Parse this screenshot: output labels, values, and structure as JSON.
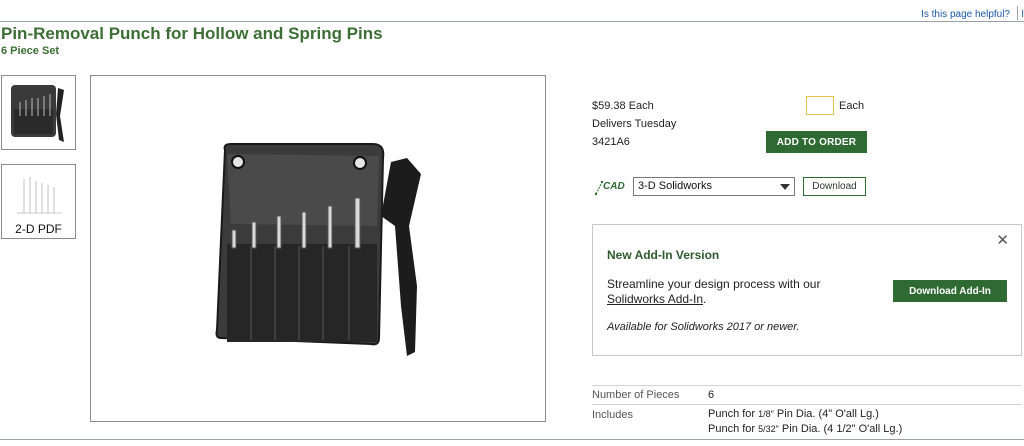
{
  "header": {
    "helpful_text": "Is this page helpful?",
    "helpful_tail": "I"
  },
  "product": {
    "title": "Pin-Removal Punch for Hollow and Spring Pins",
    "subtitle": "6 Piece Set"
  },
  "thumbnails": {
    "pdf_caption": "2-D PDF"
  },
  "order": {
    "price": "$59.38 Each",
    "delivery": "Delivers Tuesday",
    "part_number": "3421A6",
    "qty_value": "",
    "unit": "Each",
    "add_button": "ADD TO ORDER"
  },
  "cad": {
    "icon_label": "CAD",
    "selected_format": "3-D Solidworks",
    "download_button": "Download"
  },
  "addin": {
    "title": "New Add-In Version",
    "line1": "Streamline your design process with our",
    "link": "Solidworks Add-In",
    "link_tail": ".",
    "note": "Available for Solidworks 2017 or newer.",
    "button": "Download Add-In",
    "close": "✕"
  },
  "specs": [
    {
      "label": "Number of Pieces",
      "value": "6"
    },
    {
      "label": "Includes",
      "value": ""
    }
  ],
  "includes_lines": [
    {
      "prefix": "Punch for ",
      "frac": "1/8\"",
      "suffix": " Pin Dia. (4\" O'all Lg.)"
    },
    {
      "prefix": "Punch for ",
      "frac": "5/32\"",
      "suffix": " Pin Dia. (4 1/2\" O'all Lg.)"
    }
  ]
}
